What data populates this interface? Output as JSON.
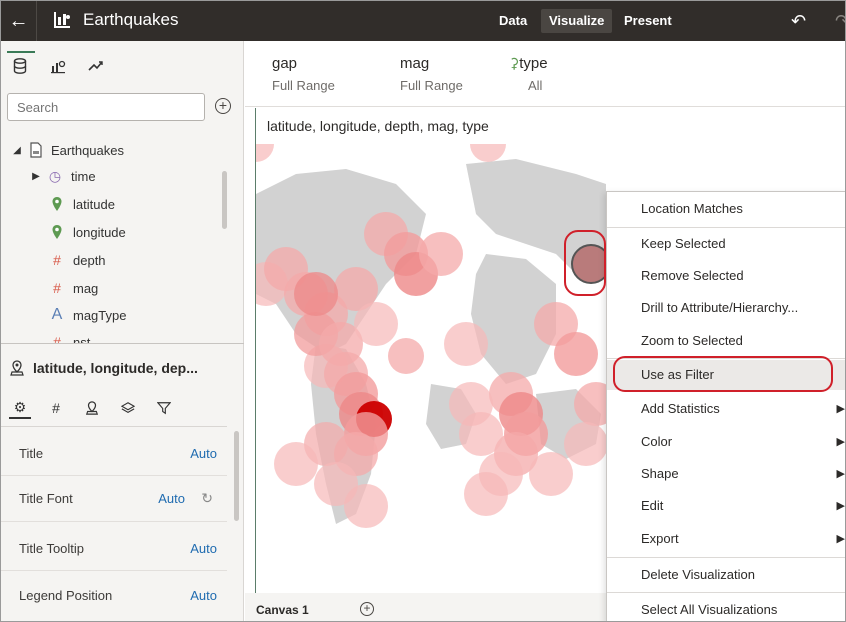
{
  "topbar": {
    "title": "Earthquakes",
    "tabs": [
      {
        "label": "Data"
      },
      {
        "label": "Visualize"
      },
      {
        "label": "Present"
      }
    ]
  },
  "left_panel": {
    "search_placeholder": "Search",
    "tree": [
      {
        "label": "Earthquakes",
        "icon": "dataset-icon"
      },
      {
        "label": "time",
        "icon": "clock-icon"
      },
      {
        "label": "latitude",
        "icon": "pin-icon"
      },
      {
        "label": "longitude",
        "icon": "pin-icon"
      },
      {
        "label": "depth",
        "icon": "hash-icon"
      },
      {
        "label": "mag",
        "icon": "hash-icon"
      },
      {
        "label": "magType",
        "icon": "text-a-icon"
      },
      {
        "label": "nst",
        "icon": "hash-icon"
      }
    ],
    "viz_title": "latitude, longitude, dep...",
    "properties": [
      {
        "label": "Title",
        "value": "Auto"
      },
      {
        "label": "Title Font",
        "value": "Auto"
      },
      {
        "label": "Title Tooltip",
        "value": "Auto"
      },
      {
        "label": "Legend Position",
        "value": "Auto"
      }
    ]
  },
  "filters": [
    {
      "name": "gap",
      "value": "Full Range"
    },
    {
      "name": "mag",
      "value": "Full Range"
    },
    {
      "name": "type",
      "value": "All"
    }
  ],
  "canvas": {
    "viz_heading": "latitude, longitude, depth, mag, type",
    "tab_label": "Canvas 1"
  },
  "context_menu": {
    "items": [
      {
        "label": "Location Matches"
      },
      {
        "label": "Keep Selected"
      },
      {
        "label": "Remove Selected"
      },
      {
        "label": "Drill to Attribute/Hierarchy..."
      },
      {
        "label": "Zoom to Selected"
      },
      {
        "label": "Use as Filter"
      },
      {
        "label": "Add Statistics"
      },
      {
        "label": "Color"
      },
      {
        "label": "Shape"
      },
      {
        "label": "Edit"
      },
      {
        "label": "Export"
      },
      {
        "label": "Delete Visualization"
      },
      {
        "label": "Select All Visualizations"
      }
    ]
  },
  "colors": {
    "topbar_bg": "#312d2a",
    "accent_green": "#3a7a57",
    "highlight_red": "#d0202a",
    "bubble_red": "#e85a5a",
    "link_blue": "#1f6bb0"
  }
}
